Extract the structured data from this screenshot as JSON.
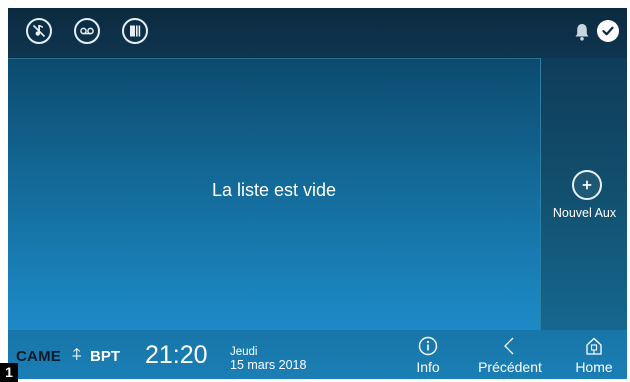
{
  "content": {
    "empty_message": "La liste est vide"
  },
  "side_panel": {
    "new_aux_label": "Nouvel Aux"
  },
  "status_bar": {
    "brand_came": "CAME",
    "brand_bpt": "BPT",
    "time": "21:20",
    "day": "Jeudi",
    "date": "15 mars 2018"
  },
  "nav": {
    "info_label": "Info",
    "back_label": "Précédent",
    "home_label": "Home"
  },
  "page_number": "1",
  "colors": {
    "screen_top": "#0a3a55",
    "screen_bottom": "#1f93d2",
    "topbar": "#0c2a3f",
    "text": "#ffffff"
  }
}
